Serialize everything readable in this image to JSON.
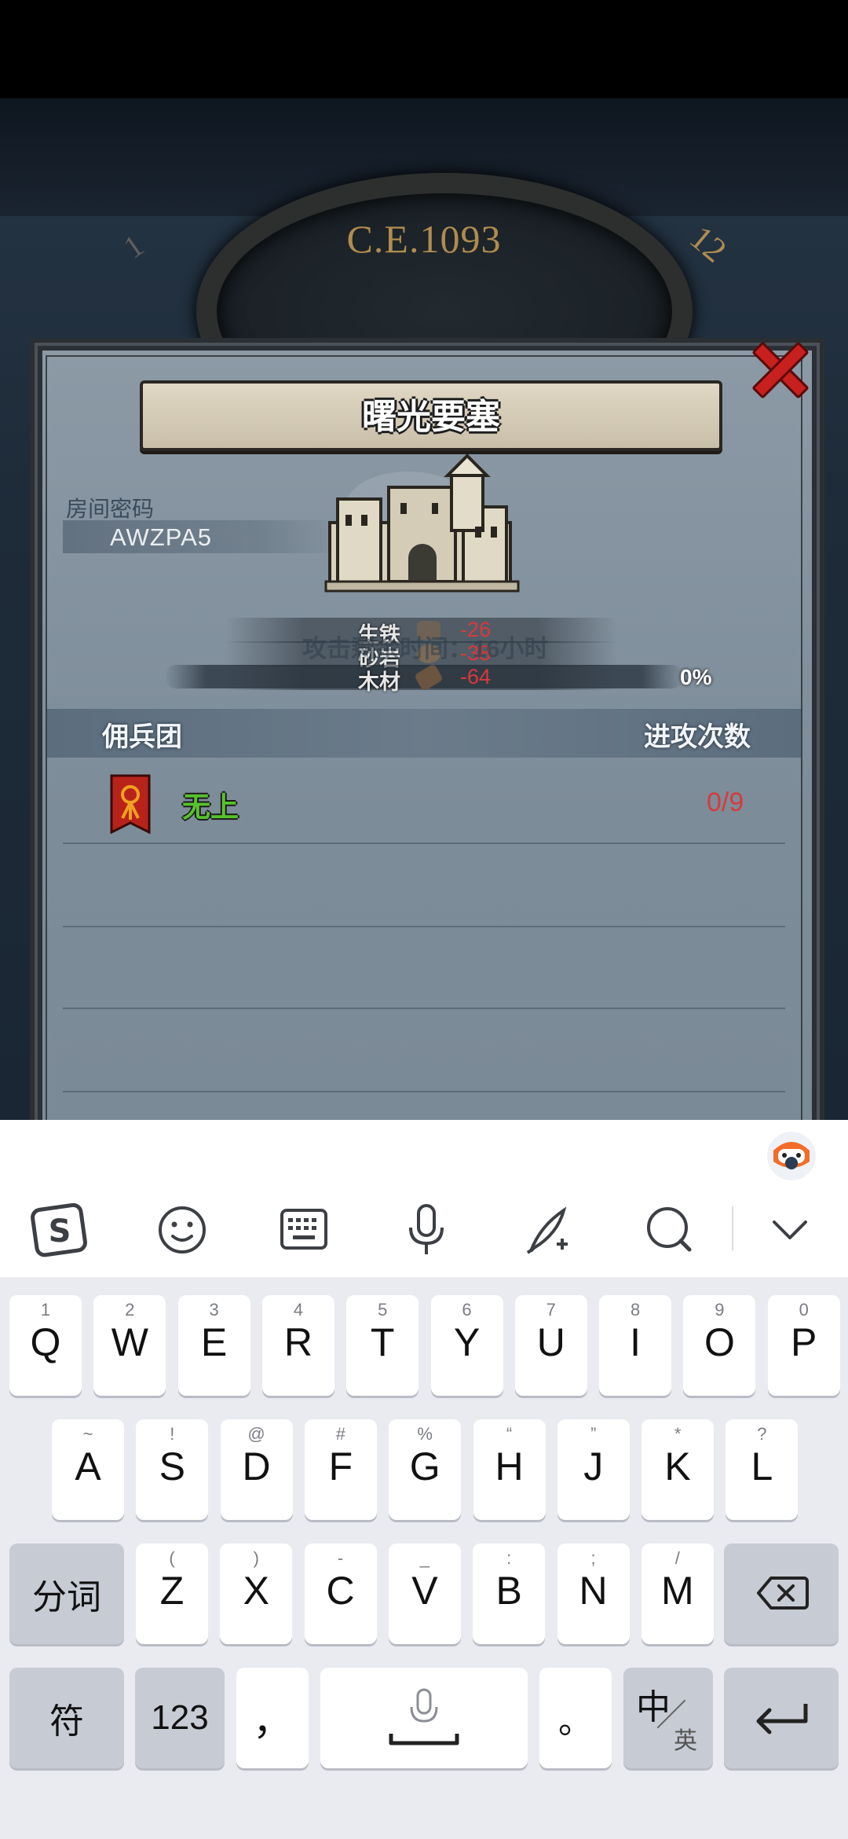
{
  "game": {
    "year": "C.E.1093",
    "clock_left_mark": "1",
    "clock_right_mark": "12",
    "dialog": {
      "title": "曙光要塞",
      "room_code_label": "房间密码",
      "room_code_value": "AWZPA5",
      "resources": [
        {
          "name": "生铁",
          "value": "-26",
          "icon": "iron-icon"
        },
        {
          "name": "砂岩",
          "value": "-38",
          "icon": "sandstone-icon"
        },
        {
          "name": "木材",
          "value": "-64",
          "icon": "wood-icon"
        }
      ],
      "attack_time_text": "攻击剩余时间：16小时",
      "progress_text": "0%",
      "progress_value": 0,
      "columns": {
        "mercenary": "佣兵团",
        "attacks": "进攻次数"
      },
      "rows": [
        {
          "team_name": "无上",
          "attacks": "0/9"
        }
      ]
    }
  },
  "keyboard": {
    "toolbar_icons": [
      "sogou-logo-icon",
      "emoji-icon",
      "keyboard-icon",
      "microphone-icon",
      "handwriting-icon",
      "search-icon",
      "chevron-down-icon"
    ],
    "row1": [
      {
        "main": "Q",
        "sub": "1"
      },
      {
        "main": "W",
        "sub": "2"
      },
      {
        "main": "E",
        "sub": "3"
      },
      {
        "main": "R",
        "sub": "4"
      },
      {
        "main": "T",
        "sub": "5"
      },
      {
        "main": "Y",
        "sub": "6"
      },
      {
        "main": "U",
        "sub": "7"
      },
      {
        "main": "I",
        "sub": "8"
      },
      {
        "main": "O",
        "sub": "9"
      },
      {
        "main": "P",
        "sub": "0"
      }
    ],
    "row2": [
      {
        "main": "A",
        "sub": "~"
      },
      {
        "main": "S",
        "sub": "!"
      },
      {
        "main": "D",
        "sub": "@"
      },
      {
        "main": "F",
        "sub": "#"
      },
      {
        "main": "G",
        "sub": "%"
      },
      {
        "main": "H",
        "sub": "“"
      },
      {
        "main": "J",
        "sub": "”"
      },
      {
        "main": "K",
        "sub": "*"
      },
      {
        "main": "L",
        "sub": "?"
      }
    ],
    "row3": [
      {
        "main": "Z",
        "sub": "("
      },
      {
        "main": "X",
        "sub": ")"
      },
      {
        "main": "C",
        "sub": "-"
      },
      {
        "main": "V",
        "sub": "_"
      },
      {
        "main": "B",
        "sub": ":"
      },
      {
        "main": "N",
        "sub": ";"
      },
      {
        "main": "M",
        "sub": "/"
      }
    ],
    "segment_label": "分词",
    "symbol_label": "符",
    "num_label": "123",
    "comma_label": "，",
    "period_label": "。",
    "lang_main": "中",
    "lang_sub": "英"
  }
}
